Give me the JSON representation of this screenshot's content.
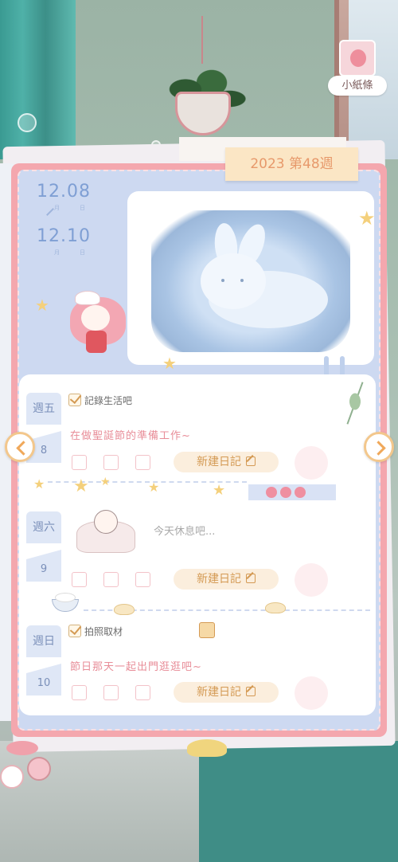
{
  "note": {
    "label": "小紙條",
    "icon": "note-avatar-icon"
  },
  "week": {
    "label": "2023 第48週"
  },
  "dates": {
    "start": {
      "value": "12.08",
      "month_unit": "月",
      "day_unit": "日"
    },
    "end": {
      "value": "12.10",
      "month_unit": "月",
      "day_unit": "日"
    }
  },
  "days": [
    {
      "weekday": "週五",
      "day": "8",
      "task": "記錄生活吧",
      "diary": "在做聖誕節的準備工作~",
      "button": "新建日記"
    },
    {
      "weekday": "週六",
      "day": "9",
      "rest": "今天休息吧...",
      "button": "新建日記"
    },
    {
      "weekday": "週日",
      "day": "10",
      "task": "拍照取材",
      "diary": "節日那天一起出門逛逛吧~",
      "button": "新建日記"
    }
  ],
  "colors": {
    "notebook": "#f4a7ae",
    "page": "#cdd9f1",
    "week_tab": "#fbe6c5",
    "accent_gold": "#d49a54",
    "diary_pink": "#e88d98",
    "date_blue": "#7f9fd4"
  },
  "icons": [
    "left-arrow-icon",
    "right-arrow-icon",
    "pen-icon",
    "gift-icon",
    "star-icon",
    "checkbox-icon"
  ]
}
